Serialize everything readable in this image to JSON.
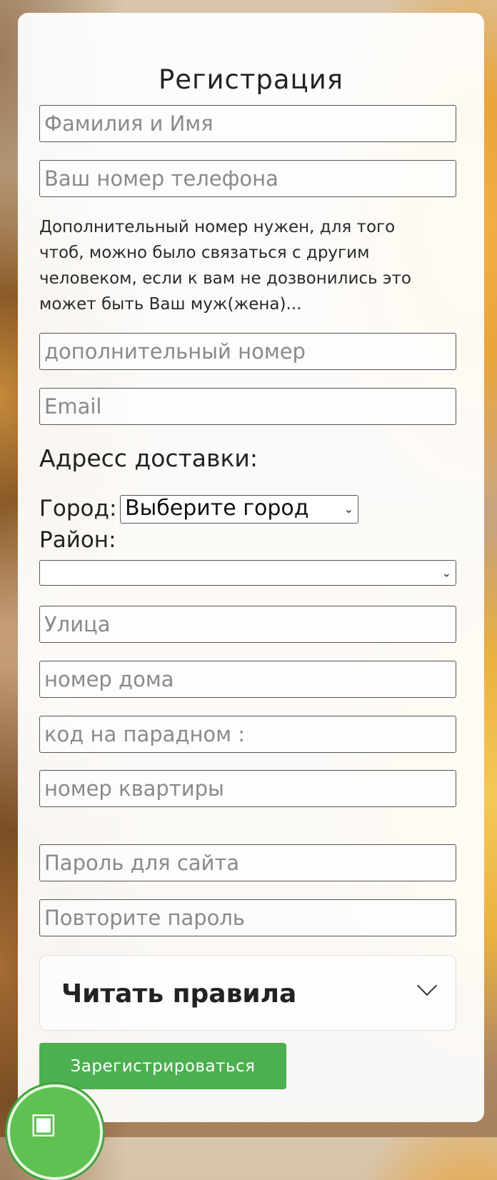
{
  "form": {
    "title": "Регистрация",
    "name_placeholder": "Фамилия и Имя",
    "phone_placeholder": "Ваш номер телефона",
    "extra_note": "Дополнительный номер нужен, для того чтоб, можно было связаться с другим человеком, если к вам не дозвонились это может быть Ваш муж(жена)...",
    "extra_phone_placeholder": "дополнительный номер",
    "email_placeholder": "Email",
    "address_heading": "Адресс доставки:",
    "city_label": "Город:",
    "city_selected": "Выберите город",
    "district_label": "Район:",
    "district_selected": "",
    "street_placeholder": "Улица",
    "house_placeholder": "номер дома",
    "entrance_code_placeholder": "код на парадном :",
    "apartment_placeholder": "номер квартиры",
    "password_placeholder": "Пароль для сайта",
    "password_repeat_placeholder": "Повторите пароль",
    "rules_label": "Читать правила",
    "submit_label": "Зарегистрироваться"
  },
  "icons": {
    "chevron": "chevron-down-icon",
    "badge": "cart-icon"
  },
  "colors": {
    "submit_bg": "#4caf50",
    "badge_bg": "#5ec152"
  }
}
